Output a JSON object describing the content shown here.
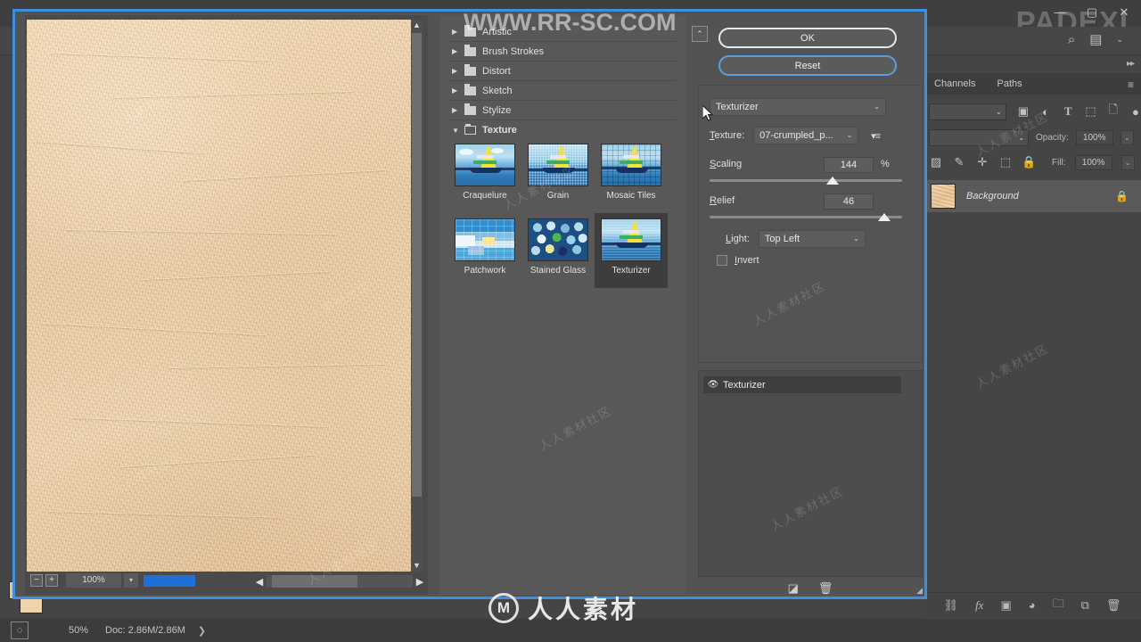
{
  "app": {
    "title_watermark": "PADEXI",
    "window_controls": {
      "minimize": "—",
      "maximize": "▢",
      "close": "✕"
    },
    "options_icons": [
      "search-icon",
      "workspace-icon",
      "chevron-down-icon"
    ],
    "dock_collapse": "▸▸"
  },
  "panels": {
    "tabs": [
      {
        "label": "Channels",
        "active": false
      },
      {
        "label": "Paths",
        "active": false
      }
    ],
    "menu_icon": "≡",
    "blend_mode": "",
    "opacity": {
      "label": "Opacity:",
      "value": "100%"
    },
    "fill": {
      "label": "Fill:",
      "value": "100%"
    },
    "row1_icons": [
      "image-icon",
      "adjustment-icon",
      "type-icon",
      "shape-icon",
      "smartobject-icon",
      "lightbulb-icon"
    ],
    "lock_icons": [
      "lock-transparency-icon",
      "lock-paint-icon",
      "lock-move-icon",
      "lock-artboard-icon",
      "lock-all-icon"
    ],
    "layers": [
      {
        "name": "Background",
        "locked": true,
        "lock_icon": "🔒"
      }
    ],
    "bottom_icons": [
      "link-icon",
      "fx-icon",
      "mask-icon",
      "adjustment-layer-icon",
      "group-icon",
      "new-layer-icon",
      "delete-layer-icon"
    ],
    "fx_label": "fx"
  },
  "status_bar": {
    "quick_mask_icon": "quick-mask-icon",
    "zoom": "50%",
    "doc_info": "Doc: 2.86M/2.86M",
    "expand_arrow": "❯"
  },
  "dialog": {
    "accent_color": "#3d8fe0",
    "preview": {
      "zoom_out": "−",
      "zoom_in": "+",
      "zoom_level": "100%",
      "zoom_caret": "▾",
      "scroll_up": "▲",
      "scroll_down": "▼",
      "scroll_left": "◀",
      "scroll_right": "▶"
    },
    "categories": [
      {
        "label": "Artistic",
        "expanded": false,
        "arrow": "▶"
      },
      {
        "label": "Brush Strokes",
        "expanded": false,
        "arrow": "▶"
      },
      {
        "label": "Distort",
        "expanded": false,
        "arrow": "▶"
      },
      {
        "label": "Sketch",
        "expanded": false,
        "arrow": "▶"
      },
      {
        "label": "Stylize",
        "expanded": false,
        "arrow": "▶"
      },
      {
        "label": "Texture",
        "expanded": true,
        "arrow": "▼"
      }
    ],
    "thumbnails": [
      {
        "label": "Craquelure",
        "selected": false,
        "style": "craquelure"
      },
      {
        "label": "Grain",
        "selected": false,
        "style": "grain"
      },
      {
        "label": "Mosaic Tiles",
        "selected": false,
        "style": "mosaic"
      },
      {
        "label": "Patchwork",
        "selected": false,
        "style": "patchwork"
      },
      {
        "label": "Stained Glass",
        "selected": false,
        "style": "stained"
      },
      {
        "label": "Texturizer",
        "selected": true,
        "style": "texturizer"
      }
    ],
    "buttons": {
      "ok": "OK",
      "reset": "Reset",
      "collapse_icon": "collapse-panel-icon",
      "collapse_glyph": "⌃"
    },
    "settings": {
      "filter_name": "Texturizer",
      "filter_caret": "⌄",
      "texture": {
        "label": "Texture:",
        "underline_char": "T",
        "value": "07-crumpled_p...",
        "caret": "⌄",
        "flyout_icon": "flyout-menu-icon"
      },
      "scaling": {
        "label": "Scaling",
        "underline_char": "S",
        "value": "144",
        "unit": "%",
        "slider_position_pct": 64
      },
      "relief": {
        "label": "Relief",
        "underline_char": "R",
        "value": "46",
        "slider_position_pct": 91
      },
      "light": {
        "label": "Light:",
        "underline_char": "L",
        "value": "Top Left",
        "caret": "⌄"
      },
      "invert": {
        "label": "Invert",
        "underline_char": "I",
        "checked": false
      }
    },
    "effect_layers": [
      {
        "name": "Texturizer",
        "visible": true,
        "eye_icon": "eye-icon"
      }
    ],
    "effect_buttons": [
      "new-effect-layer-icon",
      "delete-effect-layer-icon"
    ],
    "resize_grip": "resize-grip-icon"
  },
  "watermarks": {
    "url": "WWW.RR-SC.COM",
    "brand_logo": "M",
    "brand_text": "人人素材",
    "tile_text": "人人素材社区"
  }
}
